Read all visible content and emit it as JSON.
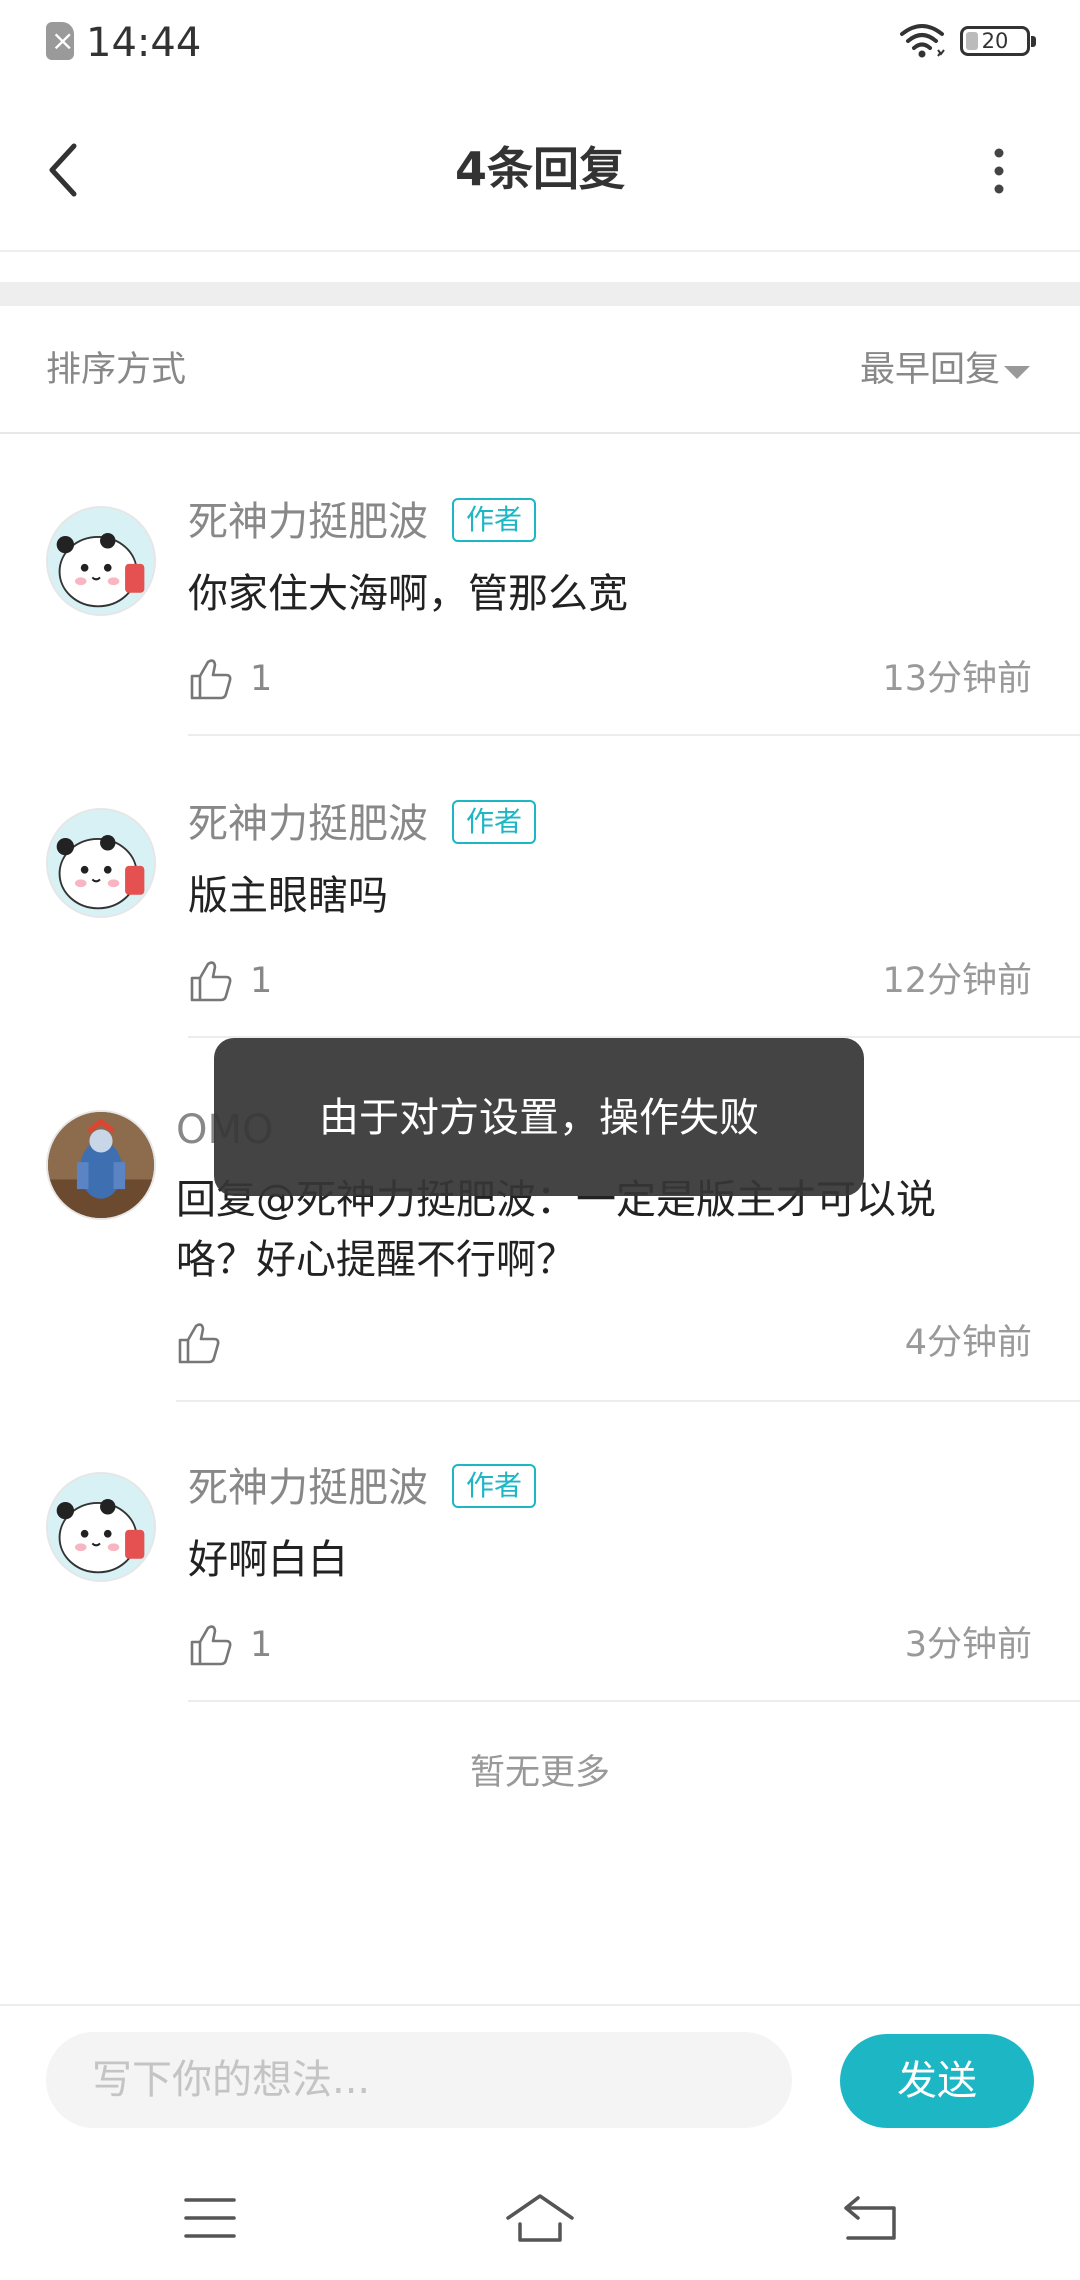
{
  "status_bar": {
    "time": "14:44",
    "battery": "20"
  },
  "header": {
    "title": "4条回复"
  },
  "sort": {
    "label": "排序方式",
    "value": "最早回复"
  },
  "comments": [
    {
      "name": "死神力挺肥波",
      "badge": "作者",
      "text": "你家住大海啊，管那么宽",
      "likes": "1",
      "time": "13分钟前"
    },
    {
      "name": "死神力挺肥波",
      "badge": "作者",
      "text": "版主眼瞎吗",
      "likes": "1",
      "time": "12分钟前"
    },
    {
      "name": "OMO",
      "badge": "",
      "text_line1": "回复@死神力挺肥波：一定是版主才可以说",
      "text_line2": "咯？好心提醒不行啊？",
      "likes": "",
      "time": "4分钟前"
    },
    {
      "name": "死神力挺肥波",
      "badge": "作者",
      "text": "好啊白白",
      "likes": "1",
      "time": "3分钟前"
    }
  ],
  "footer": {
    "no_more": "暂无更多"
  },
  "toast": {
    "text": "由于对方设置，操作失败"
  },
  "input": {
    "placeholder": "写下你的想法...",
    "send_label": "发送"
  },
  "colors": {
    "accent": "#1cb6c5",
    "toast_bg": "#363636"
  },
  "icons": [
    "sim-icon",
    "wifi-icon",
    "battery-icon",
    "back-icon",
    "more-icon",
    "thumbs-up-icon",
    "menu-icon",
    "home-icon",
    "return-icon"
  ]
}
